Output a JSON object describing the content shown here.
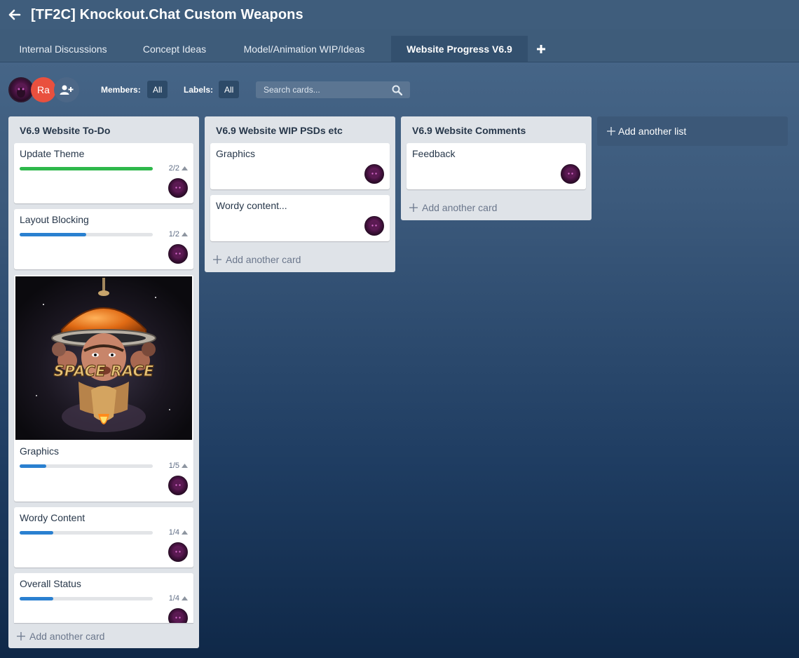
{
  "header": {
    "title": "[TF2C] Knockout.Chat Custom Weapons"
  },
  "tabs": [
    {
      "label": "Internal Discussions"
    },
    {
      "label": "Concept Ideas"
    },
    {
      "label": "Model/Animation WIP/Ideas"
    },
    {
      "label": "Website Progress V6.9",
      "active": true
    }
  ],
  "toolbar": {
    "members_label": "Members:",
    "members_value": "All",
    "labels_label": "Labels:",
    "labels_value": "All",
    "search_placeholder": "Search cards...",
    "member_initials": "Ra"
  },
  "lists": [
    {
      "title": "V6.9 Website To-Do",
      "add_card": "Add another card",
      "cards": [
        {
          "title": "Update Theme",
          "checklist": "2/2",
          "progress": 1.0,
          "bar_color": "#2eb84b"
        },
        {
          "title": "Layout Blocking",
          "checklist": "1/2",
          "progress": 0.5,
          "bar_color": "#2a80d0"
        },
        {
          "title": "Graphics",
          "checklist": "1/5",
          "progress": 0.2,
          "bar_color": "#2a80d0",
          "cover_text": "SPACE RACE"
        },
        {
          "title": "Wordy Content",
          "checklist": "1/4",
          "progress": 0.25,
          "bar_color": "#2a80d0"
        },
        {
          "title": "Overall Status",
          "checklist": "1/4",
          "progress": 0.25,
          "bar_color": "#2a80d0"
        }
      ]
    },
    {
      "title": "V6.9 Website WIP PSDs etc",
      "add_card": "Add another card",
      "cards": [
        {
          "title": "Graphics"
        },
        {
          "title": "Wordy content..."
        }
      ]
    },
    {
      "title": "V6.9 Website Comments",
      "add_card": "Add another card",
      "cards": [
        {
          "title": "Feedback"
        }
      ]
    }
  ],
  "add_list": "Add another list"
}
